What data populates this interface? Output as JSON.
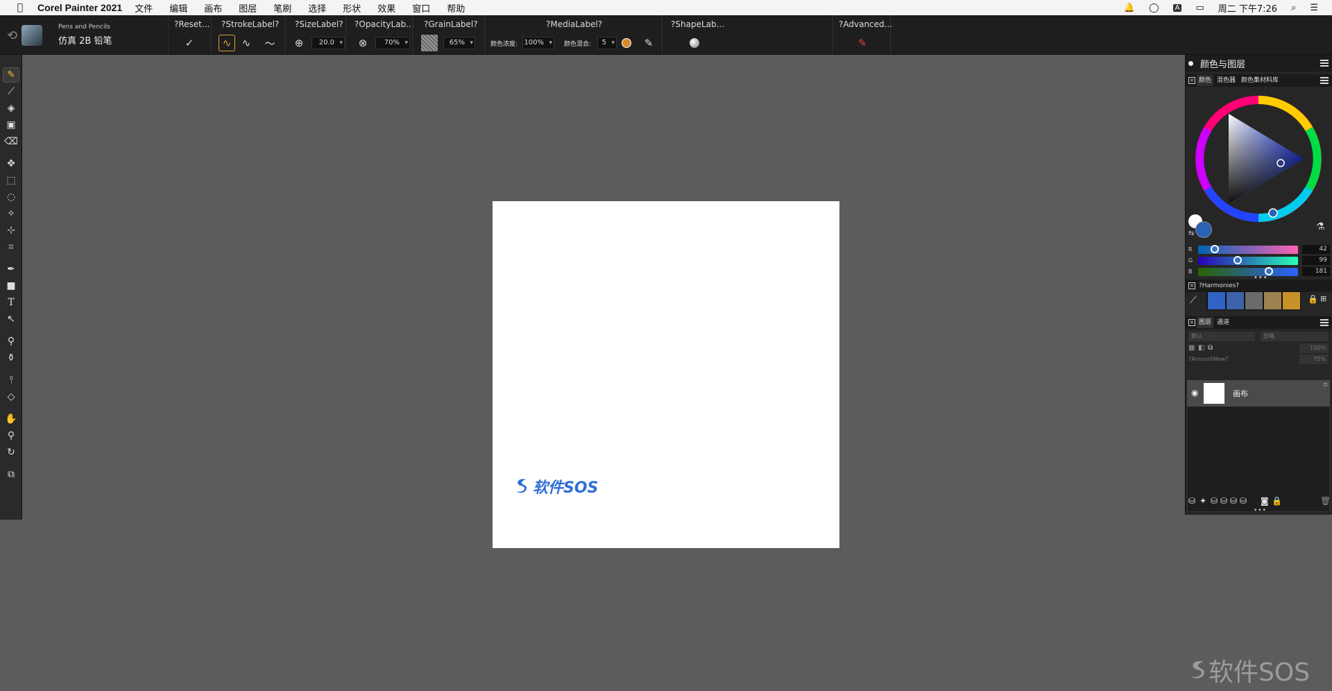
{
  "menubar": {
    "app_name": "Corel Painter 2021",
    "items": [
      "文件",
      "编辑",
      "画布",
      "图层",
      "笔刷",
      "选择",
      "形状",
      "效果",
      "窗口",
      "帮助"
    ],
    "datetime": "周二 下午7:26"
  },
  "propbar": {
    "brush_category": "Pens and Pencils",
    "brush_variant": "仿真 2B 铅笔",
    "reset_label": "?Reset...",
    "stroke_label": "?StrokeLabel?",
    "size_label": "?SizeLabel?",
    "size_value": "20.0",
    "opacity_label": "?OpacityLab...",
    "opacity_value": "70%",
    "grain_label": "?GrainLabel?",
    "grain_value": "65%",
    "media_label": "?MediaLabel?",
    "color_density_label": "颜色浓度:",
    "color_density_value": "100%",
    "color_blend_label": "颜色混合:",
    "color_blend_value": "5",
    "shape_label": "?ShapeLab...",
    "advanced_label": "?Advanced..."
  },
  "panel": {
    "title": "颜色与图层",
    "color_tabs": [
      "颜色",
      "混色器",
      "颜色集材料库"
    ],
    "rgb": [
      {
        "letter": "R",
        "value": "42"
      },
      {
        "letter": "G",
        "value": "99"
      },
      {
        "letter": "B",
        "value": "181"
      }
    ],
    "harmonies_label": "?Harmonies?",
    "harmony_swatches": [
      "#2f63c4",
      "#3d63a8",
      "#6a6a6a",
      "#9e8250",
      "#c8922a"
    ],
    "layer_tabs": [
      "图层",
      "通道"
    ],
    "blend_mode": "默认",
    "composite": "忽略",
    "opacity": "100%",
    "amount_label": "?AmountNew?",
    "amount_value": "75%",
    "layer_name": "画布"
  },
  "canvas_logo_text": "软件SOS",
  "watermark_text": "软件SOS",
  "colors": {
    "primary": "#2a63b5",
    "secondary": "#ffffff",
    "accent": "#f3b23c"
  }
}
